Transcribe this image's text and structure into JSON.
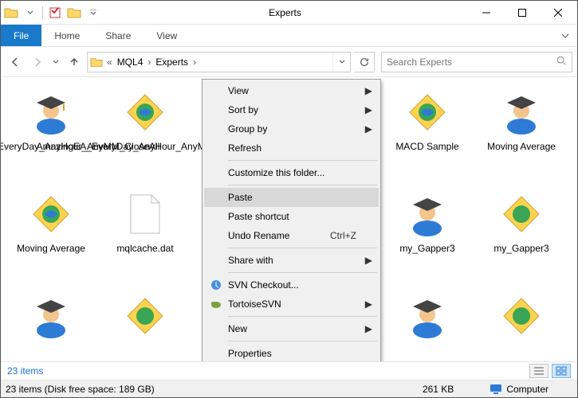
{
  "window": {
    "title": "Experts"
  },
  "ribbon": {
    "file": "File",
    "home": "Home",
    "share": "Share",
    "view": "View"
  },
  "breadcrumb": {
    "seg1": "MQL4",
    "seg2": "Experts"
  },
  "search": {
    "placeholder": "Search Experts"
  },
  "items": {
    "i0": {
      "label": "AmazingEA_EveryDay_AnyHour_AnyMM_CloseAll",
      "icon": "expert"
    },
    "i1": {
      "label": "AmazingEA_EveryDay_AnyHour_AnyMM_CloseAll",
      "icon": "compiled"
    },
    "i2": {
      "label": "",
      "icon": "expert"
    },
    "i3": {
      "label": "",
      "icon": "compiled"
    },
    "i4": {
      "label": "MACD Sample",
      "icon": "compiled"
    },
    "i5": {
      "label": "Moving Average",
      "icon": "expert"
    },
    "i6": {
      "label": "Moving Average",
      "icon": "compiled"
    },
    "i7": {
      "label": "mqlcache.dat",
      "icon": "file"
    },
    "i8": {
      "label": "",
      "icon": "expert"
    },
    "i9": {
      "label": "",
      "icon": "compiled"
    },
    "i10": {
      "label": "my_Gapper3",
      "icon": "expert"
    },
    "i11": {
      "label": "my_Gapper3",
      "icon": "compiled"
    },
    "i12": {
      "label": "",
      "icon": "expert"
    },
    "i13": {
      "label": "",
      "icon": "compiled"
    },
    "i14": {
      "label": "",
      "icon": "expert"
    },
    "i15": {
      "label": "",
      "icon": "compiled"
    },
    "i16": {
      "label": "",
      "icon": "expert"
    },
    "i17": {
      "label": "",
      "icon": "compiled"
    }
  },
  "contextMenu": {
    "view": "View",
    "sortBy": "Sort by",
    "groupBy": "Group by",
    "refresh": "Refresh",
    "customize": "Customize this folder...",
    "paste": "Paste",
    "pasteShortcut": "Paste shortcut",
    "undoRename": "Undo Rename",
    "undoShortcut": "Ctrl+Z",
    "shareWith": "Share with",
    "svnCheckout": "SVN Checkout...",
    "tortoiseSVN": "TortoiseSVN",
    "new": "New",
    "properties": "Properties"
  },
  "status": {
    "count": "23 items",
    "countFree": "23 items (Disk free space: 189 GB)",
    "size": "261 KB",
    "computer": "Computer"
  }
}
